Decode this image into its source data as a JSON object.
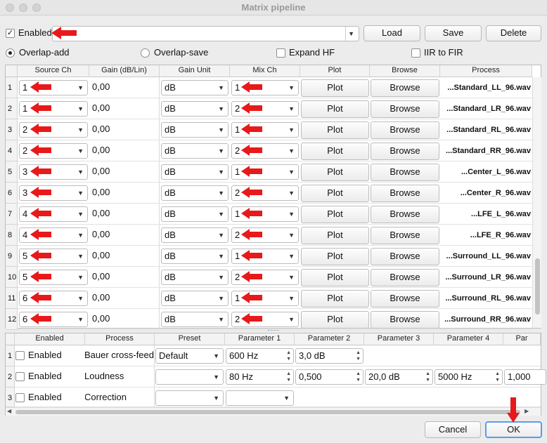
{
  "window": {
    "title": "Matrix pipeline"
  },
  "top": {
    "enabled_label": "Enabled",
    "load": "Load",
    "save": "Save",
    "delete": "Delete",
    "overlap_add": "Overlap-add",
    "overlap_save": "Overlap-save",
    "expand_hf": "Expand HF",
    "iir_to_fir": "IIR to FIR"
  },
  "matrix": {
    "headers": [
      "Source Ch",
      "Gain (dB/Lin)",
      "Gain Unit",
      "Mix Ch",
      "Plot",
      "Browse",
      "Process"
    ],
    "rows": [
      {
        "n": "1",
        "src": "1",
        "gain": "0,00",
        "unit": "dB",
        "mix": "1",
        "plot": "Plot",
        "browse": "Browse",
        "proc": "...Standard_LL_96.wav"
      },
      {
        "n": "2",
        "src": "1",
        "gain": "0,00",
        "unit": "dB",
        "mix": "2",
        "plot": "Plot",
        "browse": "Browse",
        "proc": "...Standard_LR_96.wav"
      },
      {
        "n": "3",
        "src": "2",
        "gain": "0,00",
        "unit": "dB",
        "mix": "1",
        "plot": "Plot",
        "browse": "Browse",
        "proc": "...Standard_RL_96.wav"
      },
      {
        "n": "4",
        "src": "2",
        "gain": "0,00",
        "unit": "dB",
        "mix": "2",
        "plot": "Plot",
        "browse": "Browse",
        "proc": "...Standard_RR_96.wav"
      },
      {
        "n": "5",
        "src": "3",
        "gain": "0,00",
        "unit": "dB",
        "mix": "1",
        "plot": "Plot",
        "browse": "Browse",
        "proc": "...Center_L_96.wav"
      },
      {
        "n": "6",
        "src": "3",
        "gain": "0,00",
        "unit": "dB",
        "mix": "2",
        "plot": "Plot",
        "browse": "Browse",
        "proc": "...Center_R_96.wav"
      },
      {
        "n": "7",
        "src": "4",
        "gain": "0,00",
        "unit": "dB",
        "mix": "1",
        "plot": "Plot",
        "browse": "Browse",
        "proc": "...LFE_L_96.wav"
      },
      {
        "n": "8",
        "src": "4",
        "gain": "0,00",
        "unit": "dB",
        "mix": "2",
        "plot": "Plot",
        "browse": "Browse",
        "proc": "...LFE_R_96.wav"
      },
      {
        "n": "9",
        "src": "5",
        "gain": "0,00",
        "unit": "dB",
        "mix": "1",
        "plot": "Plot",
        "browse": "Browse",
        "proc": "...Surround_LL_96.wav"
      },
      {
        "n": "10",
        "src": "5",
        "gain": "0,00",
        "unit": "dB",
        "mix": "2",
        "plot": "Plot",
        "browse": "Browse",
        "proc": "...Surround_LR_96.wav"
      },
      {
        "n": "11",
        "src": "6",
        "gain": "0,00",
        "unit": "dB",
        "mix": "1",
        "plot": "Plot",
        "browse": "Browse",
        "proc": "...Surround_RL_96.wav"
      },
      {
        "n": "12",
        "src": "6",
        "gain": "0,00",
        "unit": "dB",
        "mix": "2",
        "plot": "Plot",
        "browse": "Browse",
        "proc": "...Surround_RR_96.wav"
      }
    ]
  },
  "processes": {
    "headers": [
      "Enabled",
      "Process",
      "Preset",
      "Parameter 1",
      "Parameter 2",
      "Parameter 3",
      "Parameter 4",
      "Par"
    ],
    "rows": [
      {
        "n": "1",
        "enabled": "Enabled",
        "process": "Bauer cross-feed",
        "preset": "Default",
        "p1": "600 Hz",
        "p2": "3,0 dB",
        "p3": "",
        "p4": "",
        "p5": ""
      },
      {
        "n": "2",
        "enabled": "Enabled",
        "process": "Loudness",
        "preset": "",
        "p1": "80 Hz",
        "p2": "0,500",
        "p3": "20,0 dB",
        "p4": "5000 Hz",
        "p5": "1,000"
      },
      {
        "n": "3",
        "enabled": "Enabled",
        "process": "Correction",
        "preset": "",
        "p1": "",
        "p2": "",
        "p3": "",
        "p4": "",
        "p5": ""
      }
    ]
  },
  "footer": {
    "cancel": "Cancel",
    "ok": "OK"
  },
  "colors": {
    "arrow": "#e8191a",
    "accent_border": "#5b9bf0"
  }
}
